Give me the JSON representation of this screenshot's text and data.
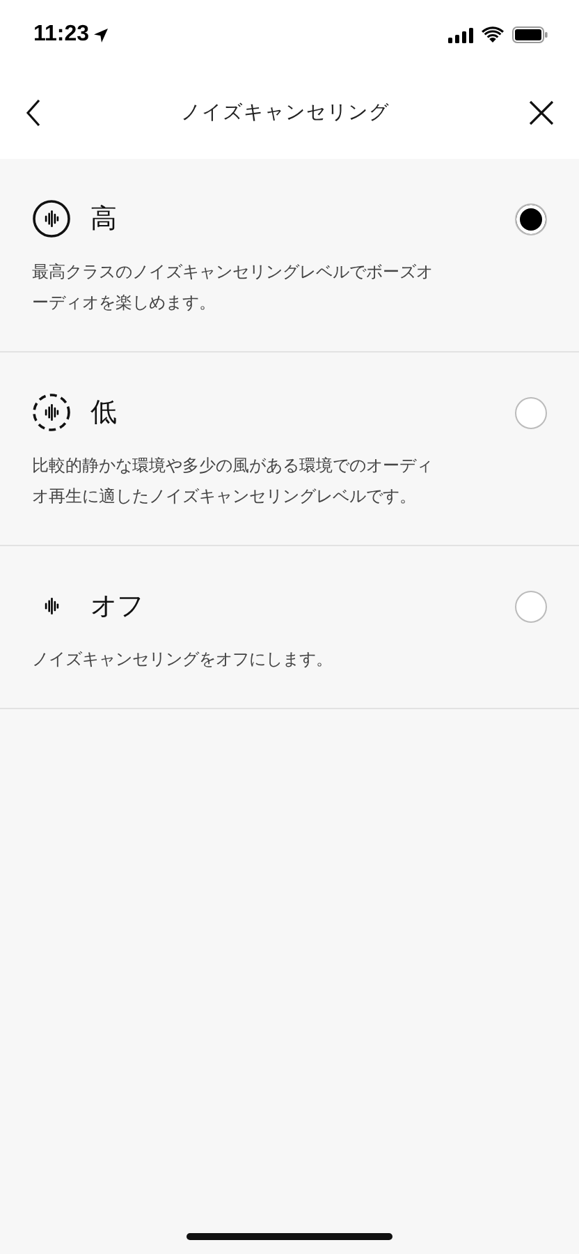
{
  "status_bar": {
    "time": "11:23"
  },
  "nav": {
    "title": "ノイズキャンセリング"
  },
  "options": [
    {
      "kind": "high",
      "label": "高",
      "description": "最高クラスのノイズキャンセリングレベルでボーズオーディオを楽しめます。",
      "selected": true
    },
    {
      "kind": "low",
      "label": "低",
      "description": "比較的静かな環境や多少の風がある環境でのオーディオ再生に適したノイズキャンセリングレベルです。",
      "selected": false
    },
    {
      "kind": "off",
      "label": "オフ",
      "description": "ノイズキャンセリングをオフにします。",
      "selected": false
    }
  ]
}
